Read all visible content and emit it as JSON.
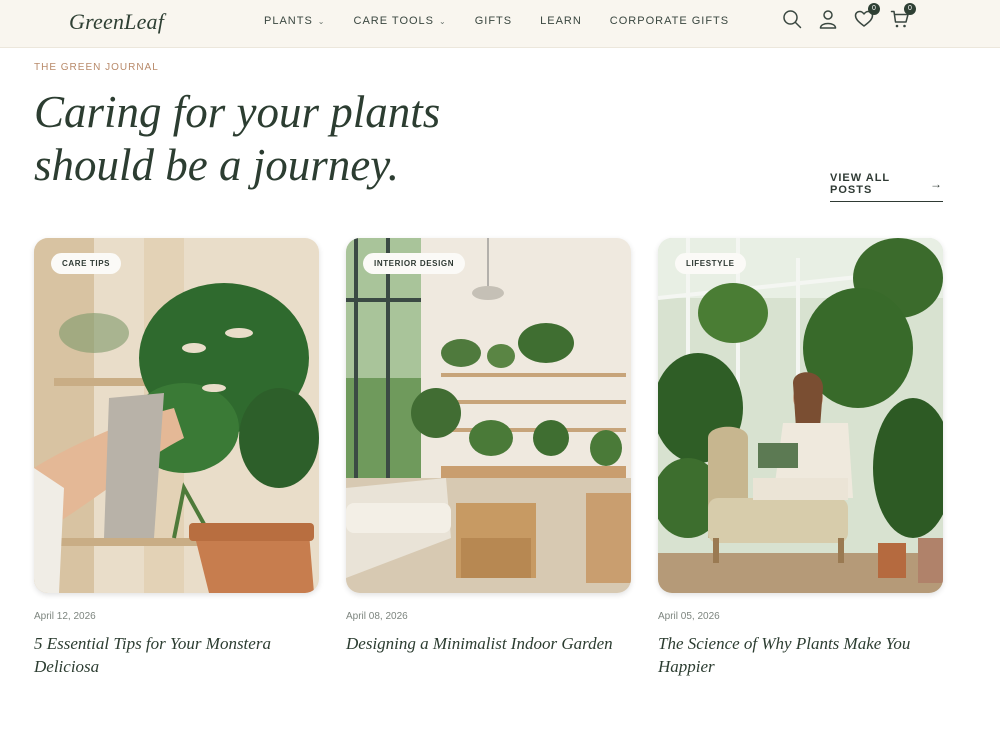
{
  "brand": {
    "logo": "GreenLeaf"
  },
  "nav": {
    "items": [
      {
        "label": "PLANTS",
        "has_dropdown": true
      },
      {
        "label": "CARE TOOLS",
        "has_dropdown": true
      },
      {
        "label": "GIFTS",
        "has_dropdown": false
      },
      {
        "label": "LEARN",
        "has_dropdown": false
      },
      {
        "label": "CORPORATE GIFTS",
        "has_dropdown": false
      }
    ],
    "dropdown_glyph": "⌄"
  },
  "header_icons": {
    "search": "search-icon",
    "account": "user-icon",
    "wishlist": "heart-icon",
    "wishlist_count": "0",
    "cart": "cart-icon",
    "cart_count": "0"
  },
  "hero": {
    "eyebrow": "THE GREEN JOURNAL",
    "headline_line1": "Caring for your plants",
    "headline_line2": "should be a journey.",
    "view_all_label": "VIEW ALL POSTS",
    "view_all_arrow": "→"
  },
  "posts": [
    {
      "tag": "CARE TIPS",
      "date": "April 12, 2026",
      "title": "5 Essential Tips for Your Monstera Deliciosa"
    },
    {
      "tag": "INTERIOR DESIGN",
      "date": "April 08, 2026",
      "title": "Designing a Minimalist Indoor Garden"
    },
    {
      "tag": "LIFESTYLE",
      "date": "April 05, 2026",
      "title": "The Science of Why Plants Make You Happier"
    }
  ],
  "colors": {
    "header_bg": "#f9f6ef",
    "brand_green": "#2c3d31",
    "eyebrow": "#b88a6a",
    "muted": "#7d857f"
  }
}
